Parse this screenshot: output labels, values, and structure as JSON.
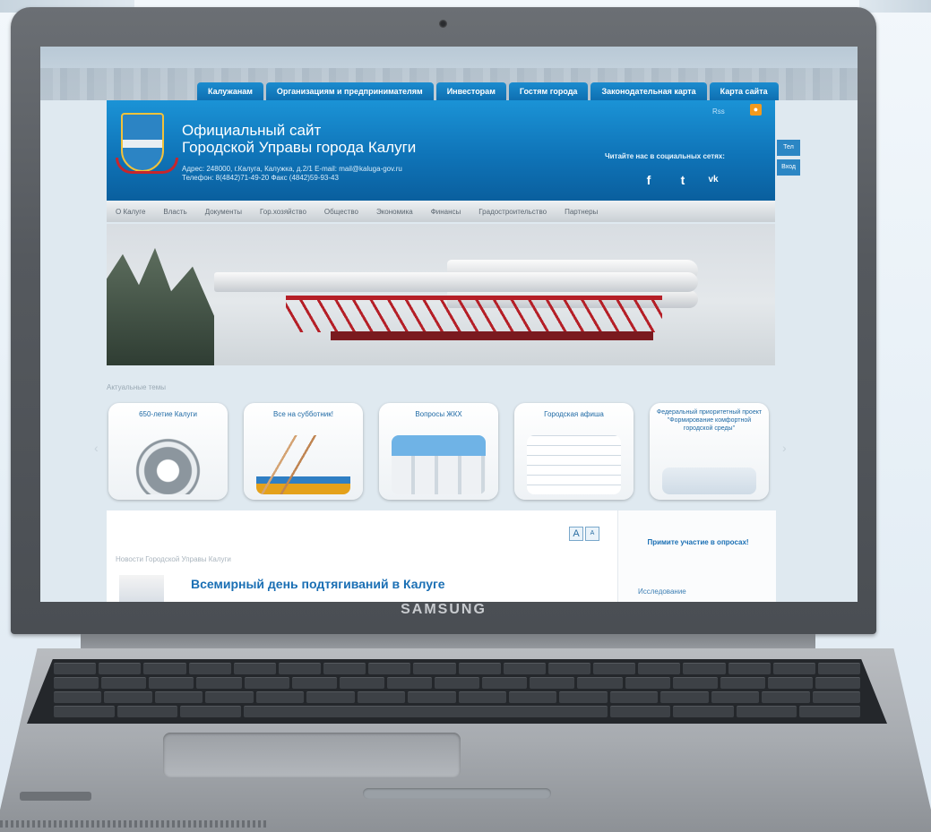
{
  "site": {
    "title_line1": "Официальный сайт",
    "title_line2": "Городской Управы города Калуги",
    "address": "Адрес: 248000, г.Калуга, Калужка, д.2/1 E-mail: mail@kaluga-gov.ru",
    "phone": "Телефон: 8(4842)71-49-20 Факс (4842)59-93-43",
    "rss_label": "Rss",
    "follow_label": "Читайте нас в социальных сетях:",
    "social": [
      "f",
      "t",
      "vk"
    ]
  },
  "top_nav": [
    "Калужанам",
    "Организациям и предпринимателям",
    "Инвесторам",
    "Гостям города",
    "Законодательная карта",
    "Карта сайта"
  ],
  "main_nav": [
    "О Калуге",
    "Власть",
    "Документы",
    "Гор.хозяйство",
    "Общество",
    "Экономика",
    "Финансы",
    "Градостроительство",
    "Партнеры"
  ],
  "side_tabs": [
    "Тел",
    "Вход"
  ],
  "topics": {
    "header": "Актуальные темы",
    "cards": [
      {
        "title": "650-летие Калуги"
      },
      {
        "title": "Все на субботник!"
      },
      {
        "title": "Вопросы ЖКХ"
      },
      {
        "title": "Городская афиша"
      },
      {
        "title": "Федеральный приоритетный проект \"Формирование комфортной городской среды\""
      }
    ]
  },
  "news": {
    "header": "Новости Городской Управы Калуги",
    "headline": "Всемирный день подтягиваний в Калуге",
    "font_small": "A",
    "font_large": "A"
  },
  "sidebar": {
    "title": "Примите участие в опросах!",
    "link": "Исследование"
  },
  "laptop": {
    "brand": "SAMSUNG"
  },
  "colors": {
    "brand_blue": "#0f74b8",
    "accent_orange": "#f39a1d",
    "gantry_red": "#b51f27"
  }
}
